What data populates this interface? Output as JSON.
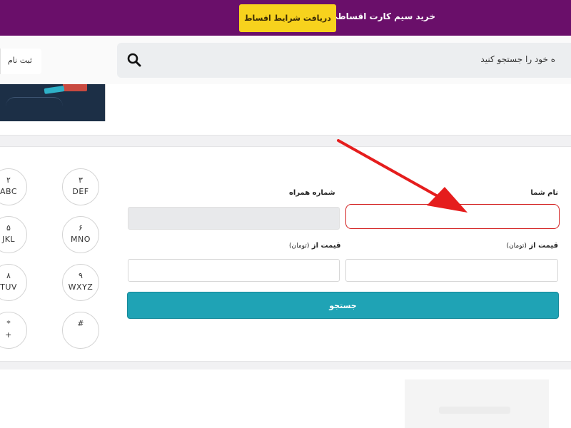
{
  "topbar": {
    "promo_text": "خرید سیم کارت اقساطی !",
    "promo_button": "دریافت شرایط اقساط",
    "background": "#6a0f6a",
    "button_color": "#f7d21d"
  },
  "header": {
    "search_placeholder": "ه خود را جستجو کنید",
    "search_icon": "search-icon",
    "signup_label": "ثبت نام"
  },
  "keypad": {
    "keys": [
      {
        "num": "۲",
        "letters": "ABC"
      },
      {
        "num": "۳",
        "letters": "DEF"
      },
      {
        "num": "۵",
        "letters": "JKL"
      },
      {
        "num": "۶",
        "letters": "MNO"
      },
      {
        "num": "۸",
        "letters": "TUV"
      },
      {
        "num": "۹",
        "letters": "WXYZ"
      },
      {
        "num": "*",
        "letters": "+"
      },
      {
        "num": "#",
        "letters": ""
      }
    ]
  },
  "form": {
    "name_label": "نام شما",
    "phone_label": "شماره همراه",
    "price_from_label_right": "قیمت از",
    "price_from_unit_right": "(تومان)",
    "price_from_label_left": "قیمت از",
    "price_from_unit_left": "(تومان)",
    "submit_label": "جستجو",
    "accent": "#1fa3b5",
    "highlight_color": "#d32020"
  },
  "annotation": {
    "arrow_color": "#e51d1d"
  }
}
